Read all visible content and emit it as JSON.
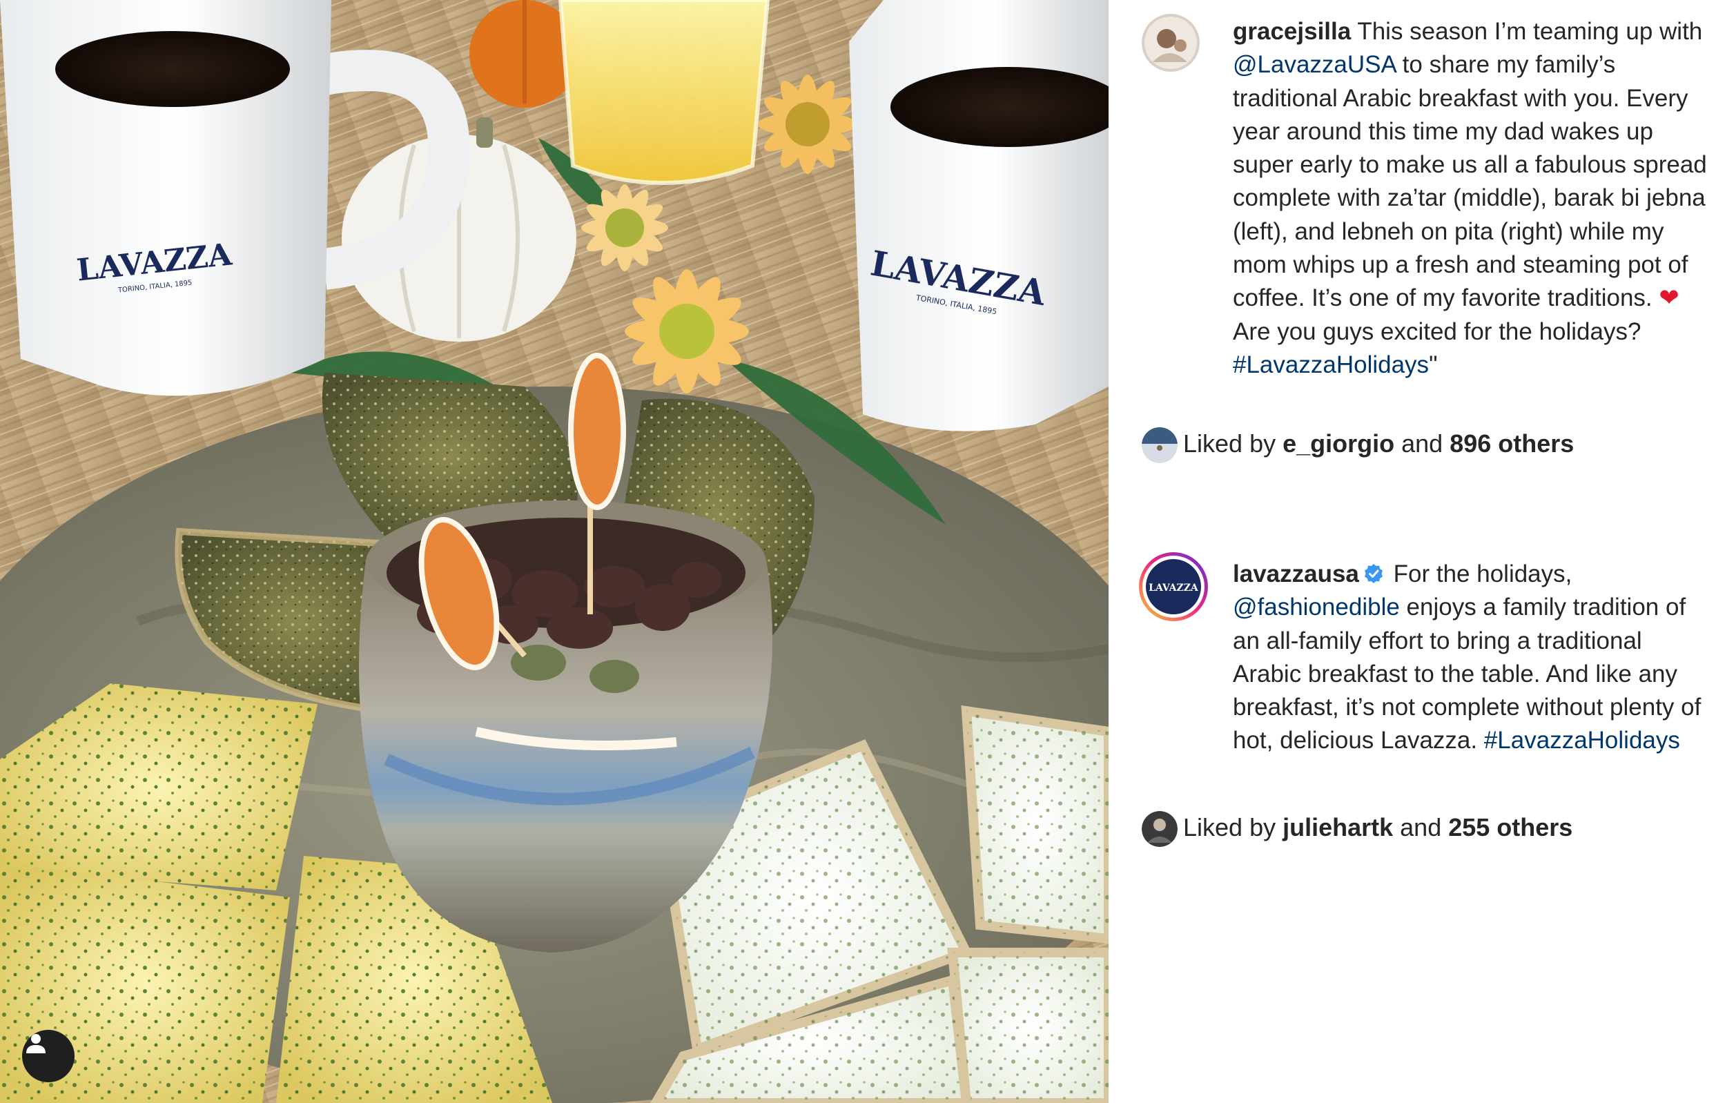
{
  "posts": [
    {
      "username": "gracejsilla",
      "caption_parts": [
        {
          "type": "text",
          "text": " This season I’m teaming up with "
        },
        {
          "type": "mention",
          "text": "@LavazzaUSA"
        },
        {
          "type": "text",
          "text": " to share my family’s traditional Arabic breakfast with you. Every year around this time my dad wakes up super early to make us all a fabulous spread complete with za’tar (middle), barak bi jebna (left), and lebneh on pita (right) while my mom whips up a fresh and steaming pot of coffee. It’s one of my favorite traditions. "
        },
        {
          "type": "emoji",
          "text": "❤"
        },
        {
          "type": "text",
          "text": " Are you guys excited for the holidays? "
        },
        {
          "type": "hashtag",
          "text": "#LavazzaHolidays"
        },
        {
          "type": "text",
          "text": "\""
        }
      ],
      "liked_by_prefix": "Liked by ",
      "liked_by_user": "e_giorgio",
      "liked_by_and": " and ",
      "liked_by_count": "896 others"
    },
    {
      "username": "lavazzausa",
      "verified": true,
      "caption_parts": [
        {
          "type": "text",
          "text": " For the holidays, "
        },
        {
          "type": "mention",
          "text": "@fashionedible"
        },
        {
          "type": "text",
          "text": " enjoys a family tradition of an all-family effort to bring a traditional Arabic breakfast to the table. And like any breakfast, it’s not complete without plenty of hot, delicious Lavazza. "
        },
        {
          "type": "hashtag",
          "text": "#LavazzaHolidays"
        }
      ],
      "liked_by_prefix": "Liked by ",
      "liked_by_user": "juliehartk",
      "liked_by_and": " and ",
      "liked_by_count": "255 others"
    }
  ],
  "photo": {
    "mug_brand": "LAVAZZA",
    "mug_subtext": "TORINO, ITALIA, 1895"
  },
  "icons": {
    "user_tag": "person-icon",
    "verified": "verified-badge-icon",
    "heart": "red-heart-emoji"
  },
  "colors": {
    "link": "#00376b",
    "text": "#262626",
    "verified_blue": "#3897f0",
    "story_ring_start": "#f9ce34",
    "story_ring_mid": "#ee2a7b",
    "story_ring_end": "#6228d7",
    "lavazza_navy": "#1b2a5c"
  }
}
